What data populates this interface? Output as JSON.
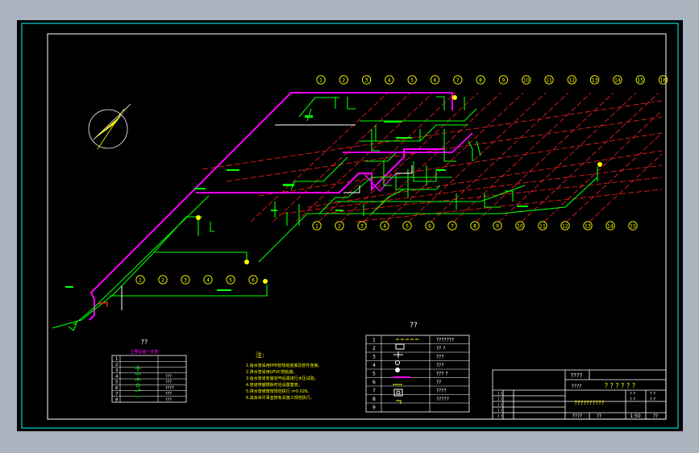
{
  "colors": {
    "background": "#000000",
    "frame": "#00ffff",
    "axis_red": "#ff2020",
    "supply_green": "#00ff00",
    "main_magenta": "#ff00ff",
    "axis_bubble": "#ffff00",
    "text_white": "#ffffff",
    "window_chrome": "#a9b4bf"
  },
  "top_grid_labels": [
    "1",
    "2",
    "3",
    "4",
    "5",
    "6",
    "7",
    "8",
    "9",
    "10",
    "11",
    "12",
    "13",
    "14",
    "15",
    "16"
  ],
  "bottom_grid_labels": [
    "1",
    "2",
    "3",
    "4",
    "5",
    "6",
    "7",
    "8",
    "9",
    "10",
    "11",
    "12",
    "13",
    "14",
    "15"
  ],
  "lower_grid_labels": [
    "1",
    "2",
    "3",
    "4",
    "5",
    "6"
  ],
  "left_legend": {
    "title": "??",
    "subtitle": "主要设备一览表",
    "rows": [
      {
        "no": "1",
        "name": ""
      },
      {
        "no": "2",
        "name": ""
      },
      {
        "no": "3",
        "name": ""
      },
      {
        "no": "4",
        "name": "???"
      },
      {
        "no": "5",
        "name": "???"
      },
      {
        "no": "6",
        "name": "????"
      },
      {
        "no": "7",
        "name": "???"
      },
      {
        "no": "8",
        "name": "???"
      }
    ]
  },
  "notes": {
    "title": "注:",
    "lines": [
      "1.给水管采用PPR管热熔连接及管件连接。",
      "2.排水管采用UPVC管粘接。",
      "3.给水管道安装完毕后需进行水压试验。",
      "4.管道穿越楼板时应设置套管。",
      "5.排水管坡度按规范执行 i=0.026。",
      "6.其余未尽事宜按有关施工规范执行。"
    ]
  },
  "symbol_legend": {
    "title": "??",
    "rows": [
      {
        "no": "1",
        "desc": "???????"
      },
      {
        "no": "2",
        "desc": "?? ?"
      },
      {
        "no": "3",
        "desc": "???"
      },
      {
        "no": "4",
        "desc": "???"
      },
      {
        "no": "5",
        "desc": "??? ?"
      },
      {
        "no": "6",
        "desc": "??"
      },
      {
        "no": "7",
        "desc": "????"
      },
      {
        "no": "8",
        "desc": "?????"
      },
      {
        "no": "9",
        "desc": ""
      }
    ]
  },
  "title_block": {
    "project_label": "????",
    "project_name": "? ? ? ? ? ?",
    "drawing_label": "????",
    "drawing_name": "??????????",
    "scale_label": "????",
    "scale_value": "??",
    "date_label": "1:50",
    "sheet_label": "??",
    "row_labels": [
      "? ?",
      "? ?",
      "? ?",
      "? ?",
      "? ?"
    ],
    "right_small": [
      "? ?",
      "? ?",
      "? ?",
      "? ?"
    ]
  }
}
